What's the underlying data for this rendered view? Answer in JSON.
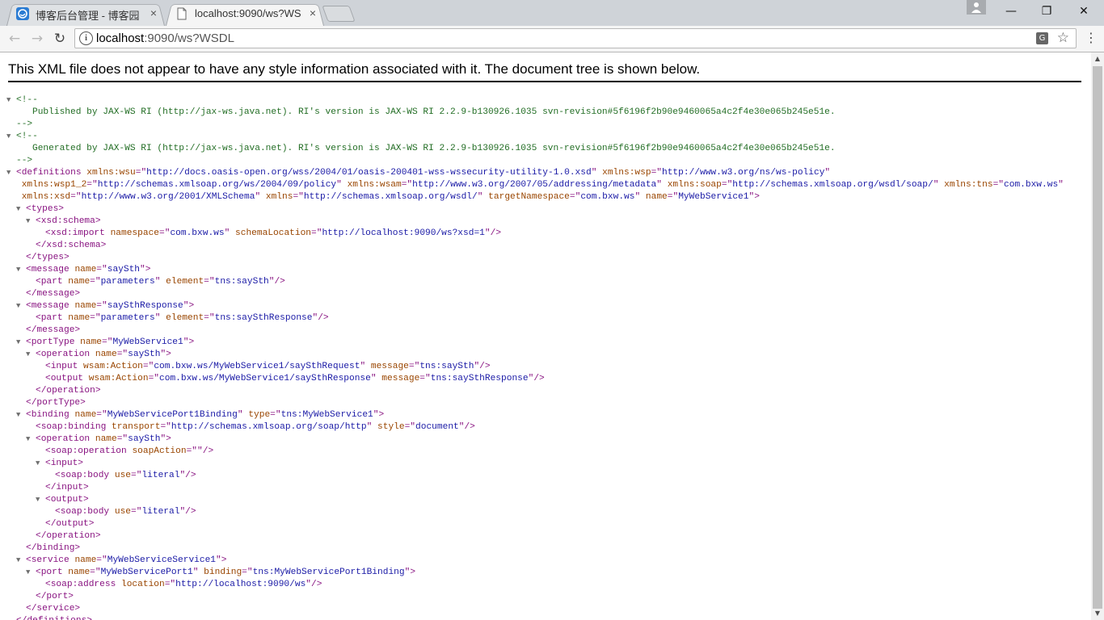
{
  "browser": {
    "tabs": [
      {
        "title": "博客后台管理 - 博客园",
        "close": "×",
        "active": false
      },
      {
        "title": "localhost:9090/ws?WSDL",
        "close": "×",
        "active": true
      }
    ],
    "window_controls": {
      "minimize": "—",
      "restore": "❐",
      "close": "✕"
    },
    "nav": {
      "back": "←",
      "forward": "→",
      "reload": "↻"
    },
    "address": {
      "host": "localhost",
      "path": ":9090/ws?WSDL"
    },
    "translate_glyph": "G",
    "star_glyph": "☆",
    "menu_glyph": "⋮"
  },
  "page": {
    "notice": "This XML file does not appear to have any style information associated with it. The document tree is shown below.",
    "triangle": "▼"
  },
  "xml": {
    "comment_open": "<!--",
    "comment_close": "-->",
    "comment1": "Published by JAX-WS RI (http://jax-ws.java.net). RI's version is JAX-WS RI 2.2.9-b130926.1035 svn-revision#5f6196f2b90e9460065a4c2f4e30e065b245e51e.",
    "comment2": "Generated by JAX-WS RI (http://jax-ws.java.net). RI's version is JAX-WS RI 2.2.9-b130926.1035 svn-revision#5f6196f2b90e9460065a4c2f4e30e065b245e51e.",
    "definitions_attrs": [
      {
        "n": "xmlns:wsu",
        "v": "http://docs.oasis-open.org/wss/2004/01/oasis-200401-wss-wssecurity-utility-1.0.xsd"
      },
      {
        "n": "xmlns:wsp",
        "v": "http://www.w3.org/ns/ws-policy"
      },
      {
        "n": "xmlns:wsp1_2",
        "v": "http://schemas.xmlsoap.org/ws/2004/09/policy"
      },
      {
        "n": "xmlns:wsam",
        "v": "http://www.w3.org/2007/05/addressing/metadata"
      },
      {
        "n": "xmlns:soap",
        "v": "http://schemas.xmlsoap.org/wsdl/soap/"
      },
      {
        "n": "xmlns:tns",
        "v": "com.bxw.ws"
      },
      {
        "n": "xmlns:xsd",
        "v": "http://www.w3.org/2001/XMLSchema"
      },
      {
        "n": "xmlns",
        "v": "http://schemas.xmlsoap.org/wsdl/"
      },
      {
        "n": "targetNamespace",
        "v": "com.bxw.ws"
      },
      {
        "n": "name",
        "v": "MyWebService1"
      }
    ],
    "lines": [
      {
        "indent": 1,
        "tri": true,
        "open": "types",
        "attrs": []
      },
      {
        "indent": 2,
        "tri": true,
        "open": "xsd:schema",
        "attrs": []
      },
      {
        "indent": 3,
        "tri": false,
        "open": "xsd:import",
        "self": true,
        "attrs": [
          {
            "n": "namespace",
            "v": "com.bxw.ws"
          },
          {
            "n": "schemaLocation",
            "v": "http://localhost:9090/ws?xsd=1"
          }
        ]
      },
      {
        "indent": 2,
        "tri": false,
        "close": "xsd:schema"
      },
      {
        "indent": 1,
        "tri": false,
        "close": "types"
      },
      {
        "indent": 1,
        "tri": true,
        "open": "message",
        "attrs": [
          {
            "n": "name",
            "v": "saySth"
          }
        ]
      },
      {
        "indent": 2,
        "tri": false,
        "open": "part",
        "self": true,
        "attrs": [
          {
            "n": "name",
            "v": "parameters"
          },
          {
            "n": "element",
            "v": "tns:saySth"
          }
        ]
      },
      {
        "indent": 1,
        "tri": false,
        "close": "message"
      },
      {
        "indent": 1,
        "tri": true,
        "open": "message",
        "attrs": [
          {
            "n": "name",
            "v": "saySthResponse"
          }
        ]
      },
      {
        "indent": 2,
        "tri": false,
        "open": "part",
        "self": true,
        "attrs": [
          {
            "n": "name",
            "v": "parameters"
          },
          {
            "n": "element",
            "v": "tns:saySthResponse"
          }
        ]
      },
      {
        "indent": 1,
        "tri": false,
        "close": "message"
      },
      {
        "indent": 1,
        "tri": true,
        "open": "portType",
        "attrs": [
          {
            "n": "name",
            "v": "MyWebService1"
          }
        ]
      },
      {
        "indent": 2,
        "tri": true,
        "open": "operation",
        "attrs": [
          {
            "n": "name",
            "v": "saySth"
          }
        ]
      },
      {
        "indent": 3,
        "tri": false,
        "open": "input",
        "self": true,
        "attrs": [
          {
            "n": "wsam:Action",
            "v": "com.bxw.ws/MyWebService1/saySthRequest"
          },
          {
            "n": "message",
            "v": "tns:saySth"
          }
        ]
      },
      {
        "indent": 3,
        "tri": false,
        "open": "output",
        "self": true,
        "attrs": [
          {
            "n": "wsam:Action",
            "v": "com.bxw.ws/MyWebService1/saySthResponse"
          },
          {
            "n": "message",
            "v": "tns:saySthResponse"
          }
        ]
      },
      {
        "indent": 2,
        "tri": false,
        "close": "operation"
      },
      {
        "indent": 1,
        "tri": false,
        "close": "portType"
      },
      {
        "indent": 1,
        "tri": true,
        "open": "binding",
        "attrs": [
          {
            "n": "name",
            "v": "MyWebServicePort1Binding"
          },
          {
            "n": "type",
            "v": "tns:MyWebService1"
          }
        ]
      },
      {
        "indent": 2,
        "tri": false,
        "open": "soap:binding",
        "self": true,
        "attrs": [
          {
            "n": "transport",
            "v": "http://schemas.xmlsoap.org/soap/http"
          },
          {
            "n": "style",
            "v": "document"
          }
        ]
      },
      {
        "indent": 2,
        "tri": true,
        "open": "operation",
        "attrs": [
          {
            "n": "name",
            "v": "saySth"
          }
        ]
      },
      {
        "indent": 3,
        "tri": false,
        "open": "soap:operation",
        "self": true,
        "attrs": [
          {
            "n": "soapAction",
            "v": ""
          }
        ]
      },
      {
        "indent": 3,
        "tri": true,
        "open": "input",
        "attrs": []
      },
      {
        "indent": 4,
        "tri": false,
        "open": "soap:body",
        "self": true,
        "attrs": [
          {
            "n": "use",
            "v": "literal"
          }
        ]
      },
      {
        "indent": 3,
        "tri": false,
        "close": "input"
      },
      {
        "indent": 3,
        "tri": true,
        "open": "output",
        "attrs": []
      },
      {
        "indent": 4,
        "tri": false,
        "open": "soap:body",
        "self": true,
        "attrs": [
          {
            "n": "use",
            "v": "literal"
          }
        ]
      },
      {
        "indent": 3,
        "tri": false,
        "close": "output"
      },
      {
        "indent": 2,
        "tri": false,
        "close": "operation"
      },
      {
        "indent": 1,
        "tri": false,
        "close": "binding"
      },
      {
        "indent": 1,
        "tri": true,
        "open": "service",
        "attrs": [
          {
            "n": "name",
            "v": "MyWebServiceService1"
          }
        ]
      },
      {
        "indent": 2,
        "tri": true,
        "open": "port",
        "attrs": [
          {
            "n": "name",
            "v": "MyWebServicePort1"
          },
          {
            "n": "binding",
            "v": "tns:MyWebServicePort1Binding"
          }
        ]
      },
      {
        "indent": 3,
        "tri": false,
        "open": "soap:address",
        "self": true,
        "attrs": [
          {
            "n": "location",
            "v": "http://localhost:9090/ws"
          }
        ]
      },
      {
        "indent": 2,
        "tri": false,
        "close": "port"
      },
      {
        "indent": 1,
        "tri": false,
        "close": "service"
      },
      {
        "indent": 0,
        "tri": false,
        "close": "definitions"
      }
    ]
  },
  "colors": {
    "tag": "#881280",
    "attr": "#994500",
    "value": "#1a1aa6",
    "comment": "#236e25"
  },
  "icons": {
    "tab1_favicon": "cnblogs-favicon-icon",
    "tab2_favicon": "page-icon",
    "info": "info-icon",
    "translate": "translate-icon",
    "star": "bookmark-star-icon",
    "menu": "menu-kebab-icon"
  }
}
